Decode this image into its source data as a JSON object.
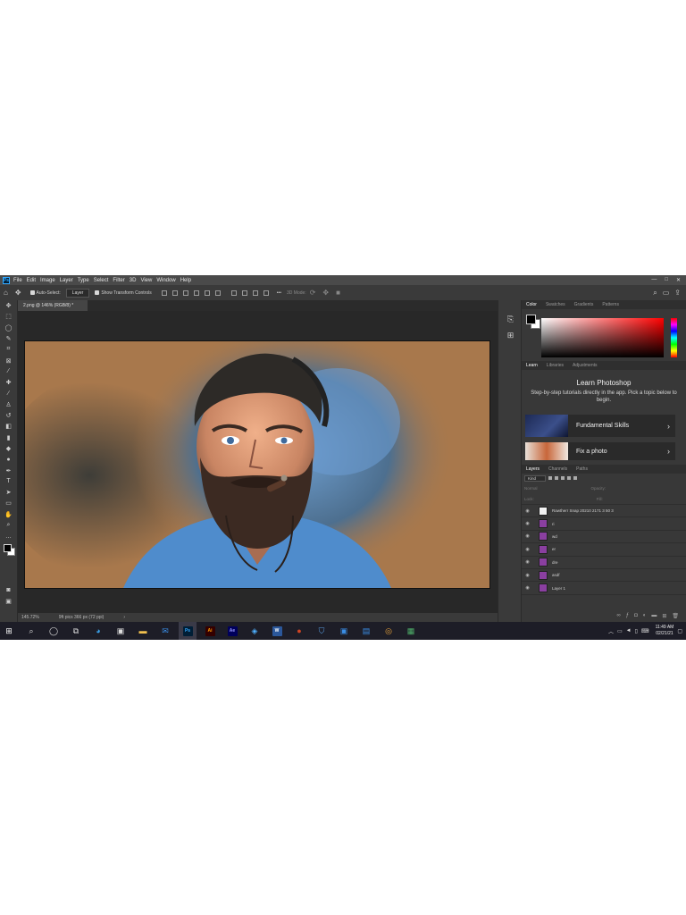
{
  "app": {
    "logo_text": "Ps",
    "menu": [
      "File",
      "Edit",
      "Image",
      "Layer",
      "Type",
      "Select",
      "Filter",
      "3D",
      "View",
      "Window",
      "Help"
    ],
    "window_controls": [
      "—",
      "□",
      "✕"
    ]
  },
  "options_bar": {
    "auto_select_label": "Auto-Select:",
    "auto_select_value": "Layer",
    "show_transform_label": "Show Transform Controls",
    "more_label": "•••",
    "mode_3d_label": "3D Mode:"
  },
  "document": {
    "tab_title": "2.png @ 146% (RGB/8) *",
    "zoom": "145.72%",
    "size_info": "9ft pics 366 px (72 ppi)"
  },
  "panels": {
    "color_tabs": [
      "Color",
      "Swatches",
      "Gradients",
      "Patterns"
    ],
    "learn_tabs": [
      "Learn",
      "Libraries",
      "Adjustments"
    ],
    "learn_title": "Learn Photoshop",
    "learn_desc": "Step-by-step tutorials directly in the app. Pick a topic below to begin.",
    "tutorials": [
      "Fundamental Skills",
      "Fix a photo"
    ],
    "layers_tabs": [
      "Layers",
      "Channels",
      "Paths"
    ],
    "kind_label": "Kind",
    "blend_mode": "Normal",
    "opacity_label": "Opacity:",
    "lock_label": "Lock:",
    "fill_label": "Fill:",
    "layers": [
      {
        "name": "Rawtherr Snap 20210 2171 3 50 3",
        "thumb": "white"
      },
      {
        "name": "ri",
        "thumb": "purple"
      },
      {
        "name": "wd",
        "thumb": "purple"
      },
      {
        "name": "er",
        "thumb": "purple"
      },
      {
        "name": "dre",
        "thumb": "purple"
      },
      {
        "name": "asdf",
        "thumb": "purple"
      },
      {
        "name": "Layer 1",
        "thumb": "purple"
      }
    ]
  },
  "taskbar": {
    "time": "11:49 AM",
    "date": "02/21/21",
    "apps": [
      "start",
      "search",
      "task-view",
      "widgets",
      "edge",
      "store",
      "file-explorer",
      "mail",
      "photoshop",
      "illustrator",
      "after-effects",
      "photos",
      "word",
      "powerpoint",
      "security",
      "video-editor",
      "mail-app",
      "chrome",
      "notes"
    ]
  },
  "colors": {
    "ui_bg": "#535353",
    "panel_bg": "#383838",
    "canvas_bg": "#a8784c",
    "ps_blue": "#31a8ff",
    "layer_thumb": "#8a3fa0"
  }
}
